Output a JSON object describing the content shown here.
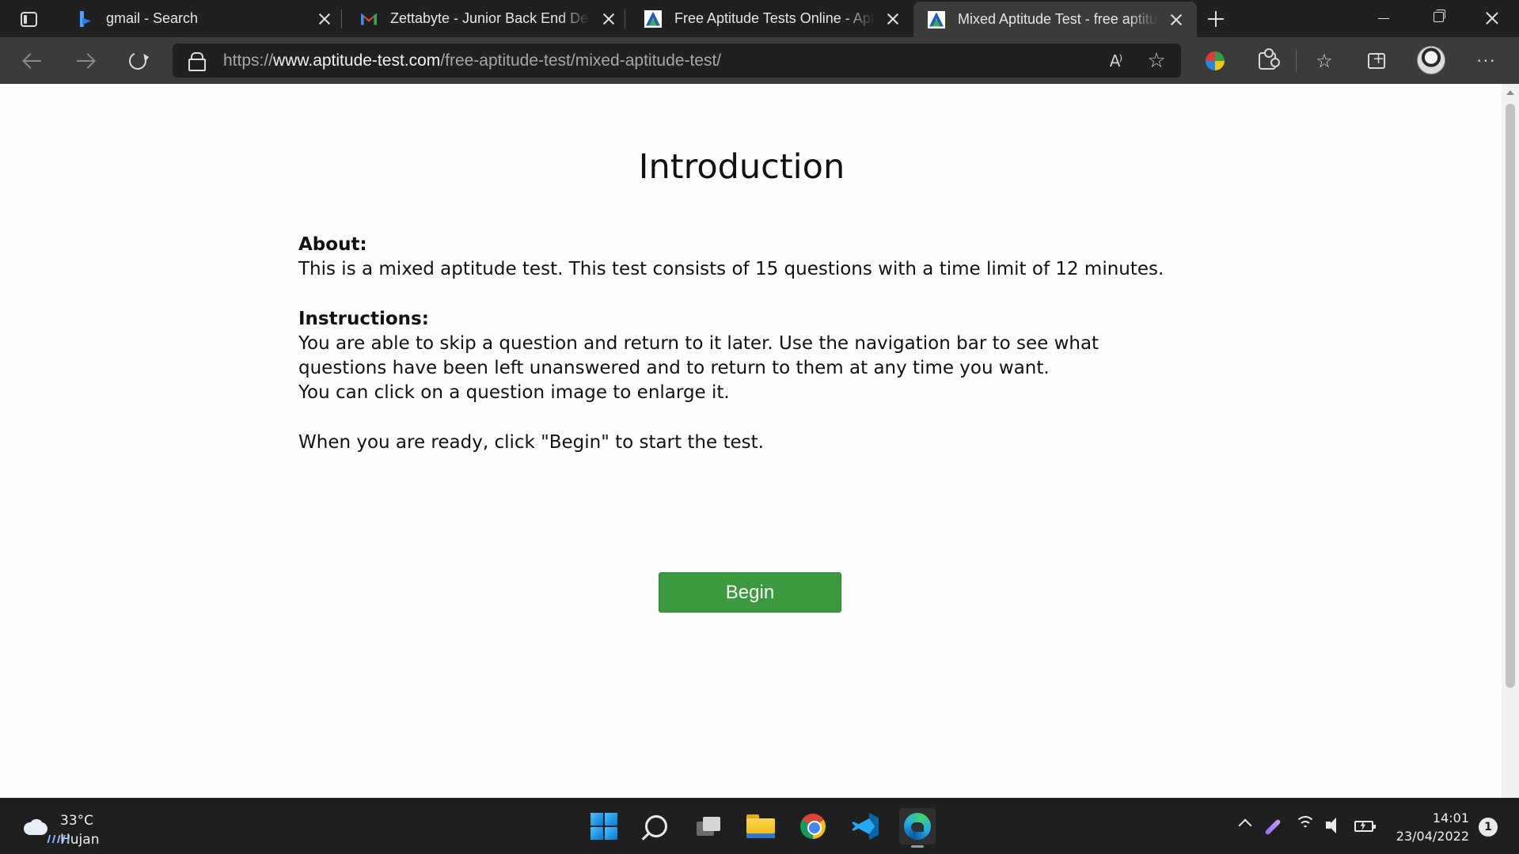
{
  "browser": {
    "tabs": [
      {
        "title": "gmail - Search",
        "favicon": "bing-icon",
        "active": false
      },
      {
        "title": "Zettabyte - Junior Back End Developer",
        "favicon": "gmail-icon",
        "active": false
      },
      {
        "title": "Free Aptitude Tests Online - Aptitude Test",
        "favicon": "aptitude-test-icon",
        "active": false
      },
      {
        "title": "Mixed Aptitude Test - free aptitude test",
        "favicon": "aptitude-test-icon",
        "active": true
      }
    ],
    "address": {
      "scheme": "https://",
      "host": "www.aptitude-test.com",
      "path": "/free-aptitude-test/mixed-aptitude-test/"
    },
    "read_aloud_label": "A⁾"
  },
  "page": {
    "title": "Introduction",
    "about_heading": "About:",
    "about_text": "This is a mixed aptitude test. This test consists of 15 questions with a time limit of 12 minutes.",
    "instructions_heading": "Instructions:",
    "instructions_line1": "You are able to skip a question and return to it later. Use the navigation bar to see what questions have been left unanswered and to return to them at any time you want.",
    "instructions_line2": "You can click on a question image to enlarge it.",
    "ready_text": "When you are ready, click \"Begin\" to start the test.",
    "begin_label": "Begin",
    "begin_color": "#3b9a3e"
  },
  "taskbar": {
    "weather": {
      "temp": "33°C",
      "condition": "Hujan"
    },
    "clock": {
      "time": "14:01",
      "date": "23/04/2022"
    },
    "notification_count": "1"
  }
}
